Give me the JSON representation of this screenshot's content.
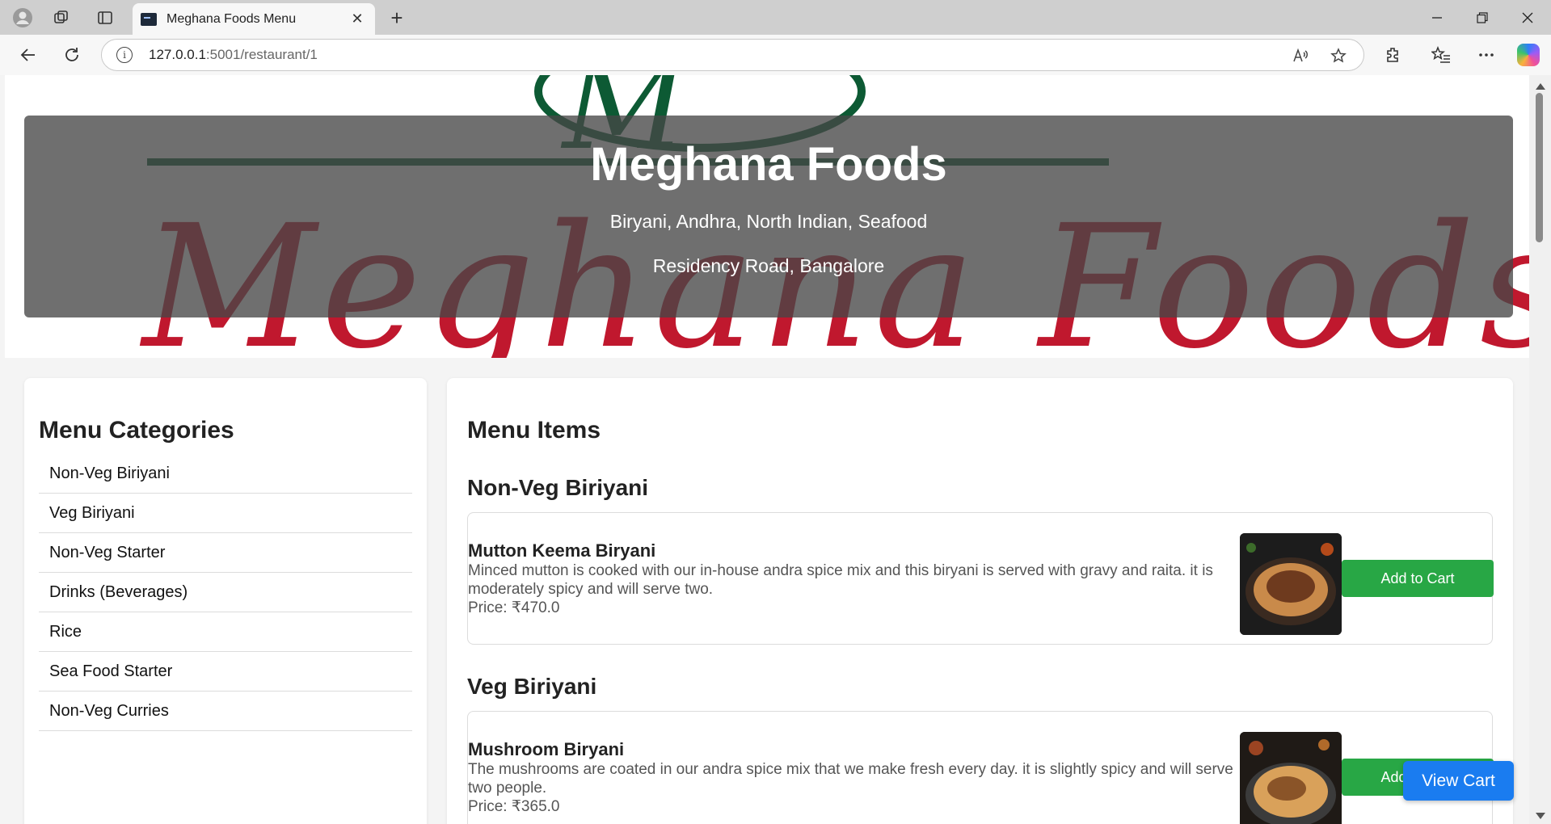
{
  "browser": {
    "tab_title": "Meghana Foods Menu",
    "url_host": "127.0.0.1",
    "url_path": ":5001/restaurant/1"
  },
  "restaurant": {
    "name": "Meghana Foods",
    "cuisines": "Biryani, Andhra, North Indian, Seafood",
    "location": "Residency Road, Bangalore",
    "logo_text": "Meghana Foods",
    "logo_initial": "M"
  },
  "sidebar": {
    "title": "Menu Categories",
    "categories": [
      "Non-Veg Biriyani",
      "Veg Biriyani",
      "Non-Veg Starter",
      "Drinks (Beverages)",
      "Rice",
      "Sea Food Starter",
      "Non-Veg Curries"
    ]
  },
  "menu": {
    "title": "Menu Items",
    "sections": [
      {
        "name": "Non-Veg Biriyani",
        "item": {
          "name": "Mutton Keema Biryani",
          "description": "Minced mutton is cooked with our in-house andra spice mix and this biryani is served with gravy and raita. it is moderately spicy and will serve two.",
          "price": "Price: ₹470.0",
          "button": "Add to Cart"
        }
      },
      {
        "name": "Veg Biriyani",
        "item": {
          "name": "Mushroom Biryani",
          "description": "The mushrooms are coated in our andra spice mix that we make fresh every day. it is slightly spicy and will serve two people.",
          "price": "Price: ₹365.0",
          "button": "Add to Cart"
        }
      }
    ]
  },
  "cart_button": "View Cart",
  "colors": {
    "accent_green": "#28a745",
    "accent_blue": "#1a7cf0",
    "logo_red": "#c0182e",
    "logo_green": "#0d5a34"
  }
}
